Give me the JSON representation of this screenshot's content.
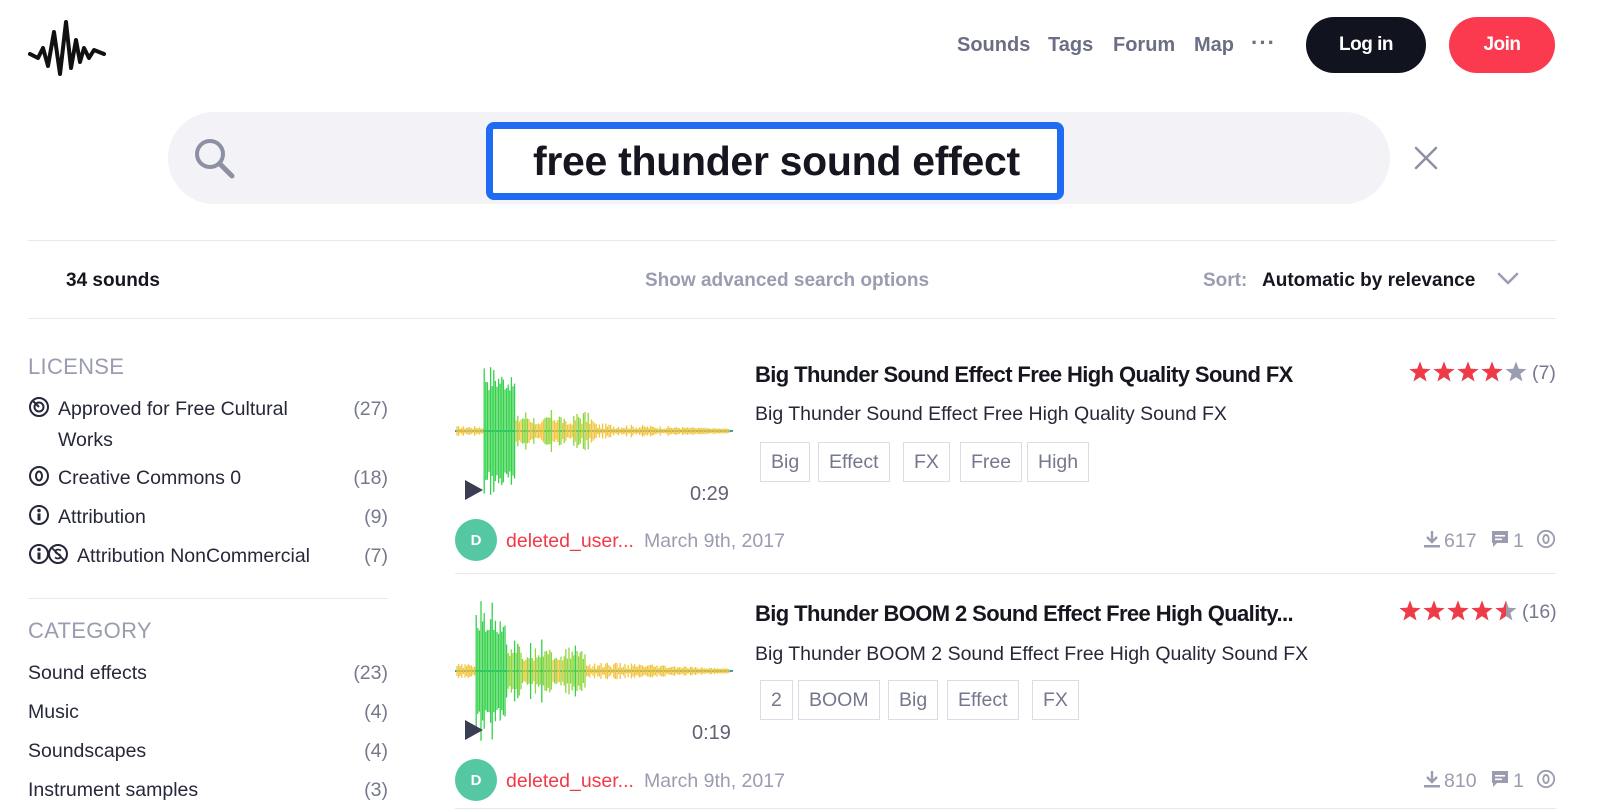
{
  "header": {
    "nav": [
      "Sounds",
      "Tags",
      "Forum",
      "Map"
    ],
    "more": "···",
    "login_label": "Log in",
    "join_label": "Join"
  },
  "search": {
    "query": "free thunder sound effect",
    "focus_color": "#1f6bf2"
  },
  "results": {
    "count": "34 sounds",
    "advanced_label": "Show advanced search options",
    "sort_label": "Sort:",
    "sort_value": "Automatic by relevance"
  },
  "sidebar": {
    "license": {
      "title": "LICENSE",
      "items": [
        {
          "label": "Approved for Free Cultural Works",
          "count": "(27)",
          "icon": "free-cultural-works-icon"
        },
        {
          "label": "Creative Commons 0",
          "count": "(18)",
          "icon": "cc0-icon"
        },
        {
          "label": "Attribution",
          "count": "(9)",
          "icon": "attribution-icon"
        },
        {
          "label": "Attribution NonCommercial",
          "count": "(7)",
          "icon": "attribution-noncommercial-icon"
        }
      ]
    },
    "category": {
      "title": "CATEGORY",
      "items": [
        {
          "label": "Sound effects",
          "count": "(23)"
        },
        {
          "label": "Music",
          "count": "(4)"
        },
        {
          "label": "Soundscapes",
          "count": "(4)"
        },
        {
          "label": "Instrument samples",
          "count": "(3)"
        }
      ]
    }
  },
  "sounds": [
    {
      "title": "Big Thunder Sound Effect Free High Quality Sound FX",
      "description": "Big Thunder Sound Effect Free High Quality Sound FX",
      "duration": "0:29",
      "tags": [
        "Big",
        "Effect",
        "FX",
        "Free",
        "High"
      ],
      "rating": 4.0,
      "rating_count": "(7)",
      "avatar_letter": "D",
      "username": "deleted_user...",
      "date": "March 9th, 2017",
      "downloads": "617",
      "comments": "1",
      "license_icon": "cc0-icon"
    },
    {
      "title": "Big Thunder BOOM 2 Sound Effect Free High Quality...",
      "description": "Big Thunder BOOM 2 Sound Effect Free High Quality Sound FX",
      "duration": "0:19",
      "tags": [
        "2",
        "BOOM",
        "Big",
        "Effect",
        "FX"
      ],
      "rating": 4.5,
      "rating_count": "(16)",
      "avatar_letter": "D",
      "username": "deleted_user...",
      "date": "March 9th, 2017",
      "downloads": "810",
      "comments": "1",
      "license_icon": "cc0-icon"
    }
  ],
  "colors": {
    "accent_red": "#fb3a4f",
    "star_red": "#f03a47",
    "dark": "#11131f",
    "avatar": "#55c7a2"
  }
}
